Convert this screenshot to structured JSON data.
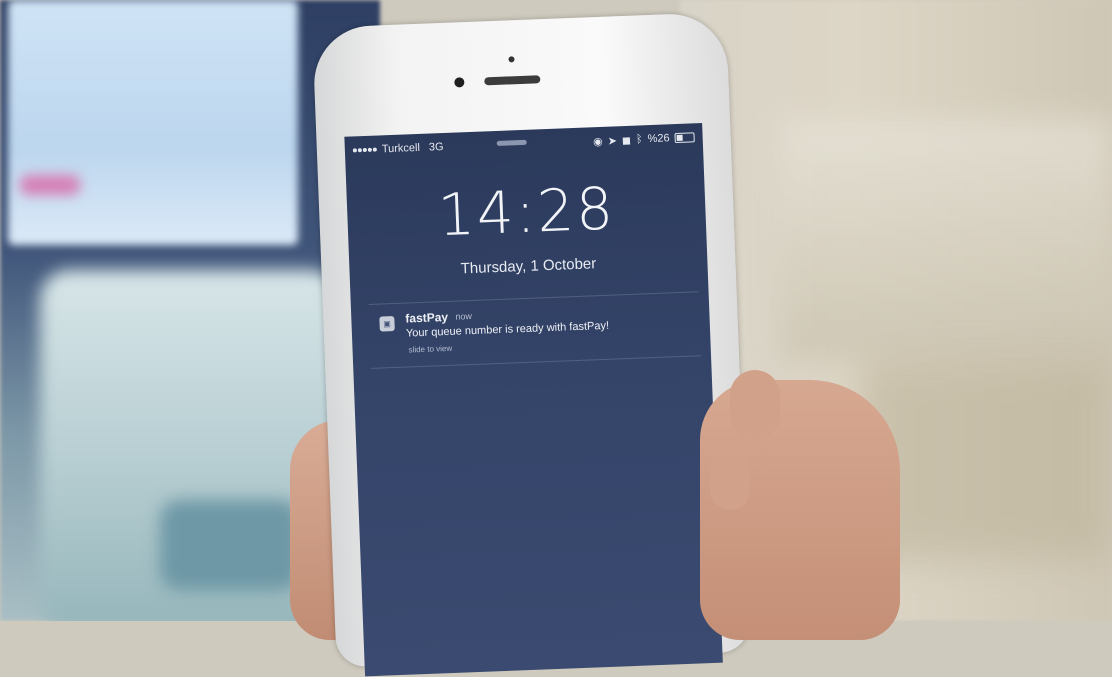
{
  "lockscreen": {
    "carrier": "Turkcell",
    "network": "3G",
    "battery_text": "%26",
    "time": "14:28",
    "date": "Thursday, 1 October"
  },
  "notification": {
    "app_name": "fastPay",
    "timestamp": "now",
    "message": "Your queue number is ready with fastPay!",
    "hint": "slide to view"
  },
  "icons": [
    "signal-icon",
    "location-icon",
    "alarm-icon",
    "bluetooth-icon",
    "battery-icon",
    "app-icon"
  ]
}
